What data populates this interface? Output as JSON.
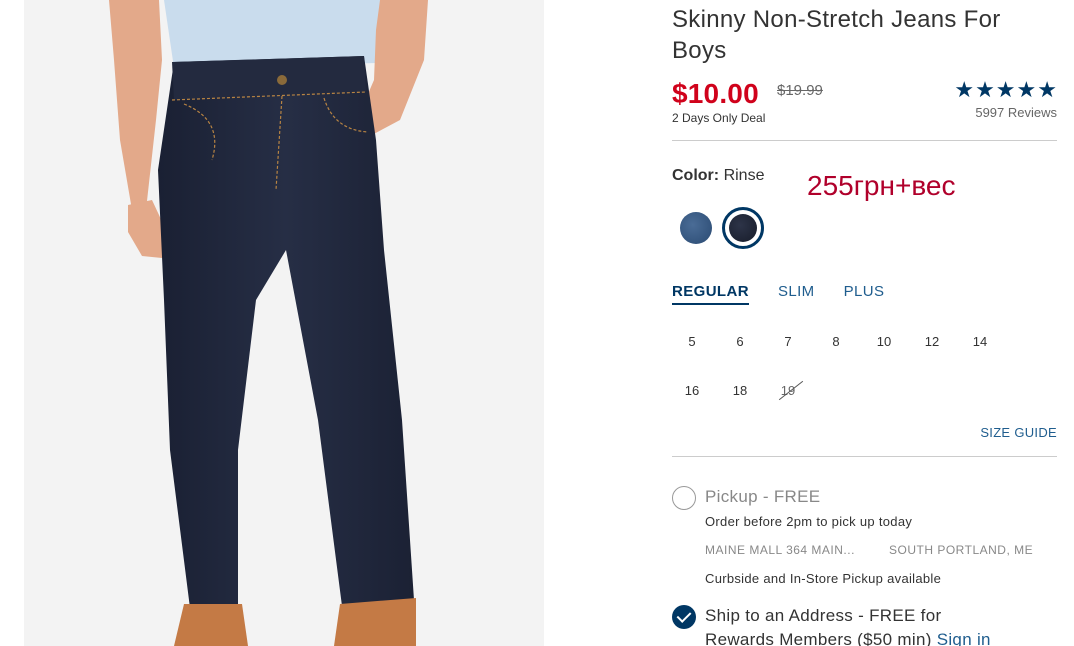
{
  "product": {
    "title": "Skinny Non-Stretch Jeans For Boys",
    "price": "$10.00",
    "was_price": "$19.99",
    "deal_text": "2 Days Only Deal",
    "rating": 4.5,
    "reviews": "5997 Reviews"
  },
  "color": {
    "label": "Color:",
    "value": "Rinse",
    "swatches": [
      {
        "name": "medium-wash",
        "hex": "#3b5b85"
      },
      {
        "name": "rinse",
        "hex": "#1f2434",
        "selected": true
      }
    ]
  },
  "annotation": "255грн+вес",
  "fit_tabs": [
    {
      "label": "REGULAR",
      "active": true
    },
    {
      "label": "SLIM",
      "active": false
    },
    {
      "label": "PLUS",
      "active": false
    }
  ],
  "sizes": [
    {
      "label": "5"
    },
    {
      "label": "6"
    },
    {
      "label": "7"
    },
    {
      "label": "8"
    },
    {
      "label": "10"
    },
    {
      "label": "12"
    },
    {
      "label": "14"
    },
    {
      "label": "16"
    },
    {
      "label": "18"
    },
    {
      "label": "19",
      "unavailable": true
    }
  ],
  "size_guide": "SIZE GUIDE",
  "fulfillment": {
    "pickup": {
      "label": "Pickup - FREE",
      "sub": "Order before 2pm to pick up today",
      "store": "MAINE MALL 364 MAIN...",
      "city": "SOUTH PORTLAND, ME",
      "note": "Curbside and In-Store Pickup available"
    },
    "ship": {
      "line1": "Ship to an Address - FREE for",
      "line2": "Rewards Members ($50 min)",
      "signin": "Sign in"
    }
  },
  "colors": {
    "accent": "#003764",
    "sale": "#d0021b",
    "link": "#1f5d8e"
  }
}
